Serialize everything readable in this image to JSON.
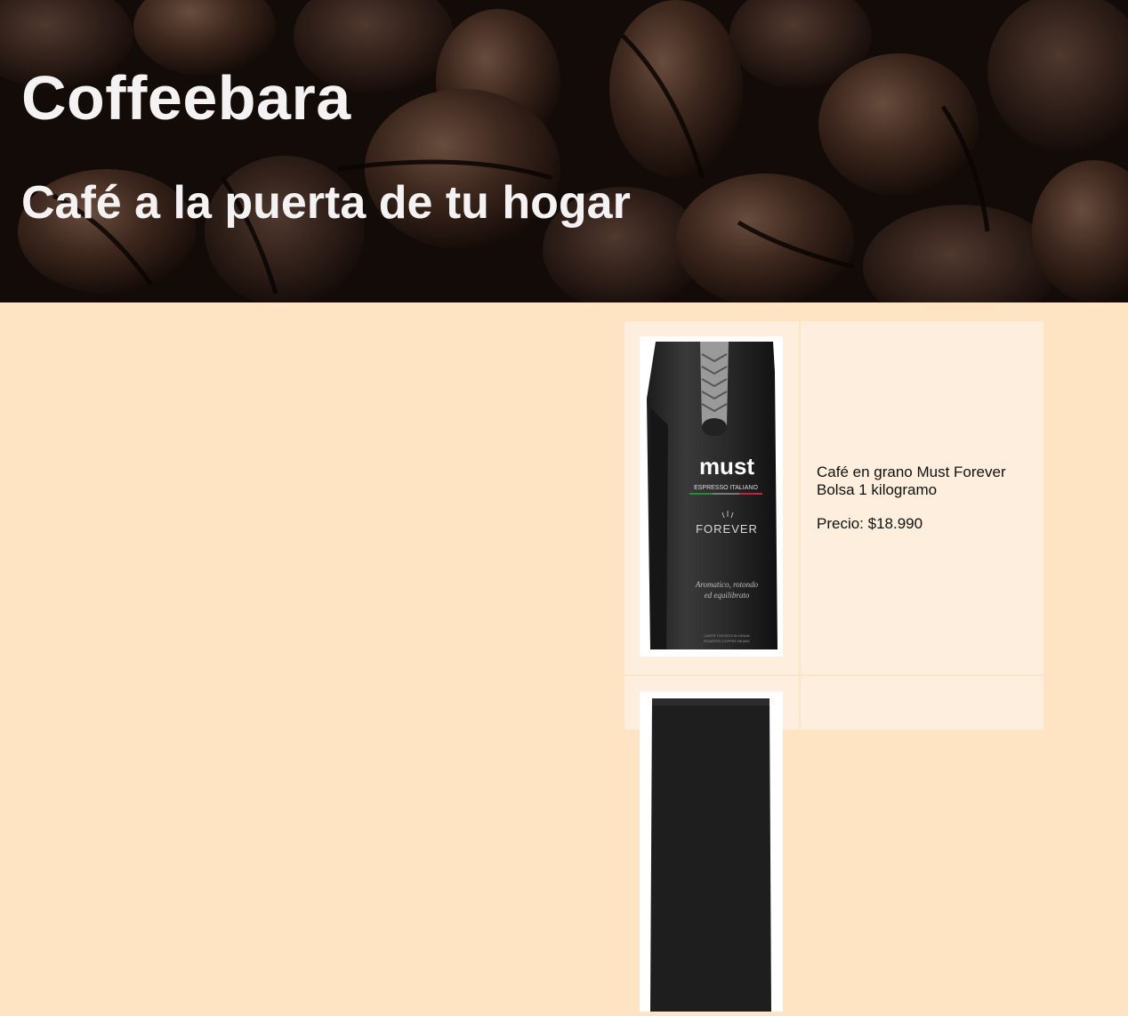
{
  "header": {
    "title": "Coffeebara",
    "subtitle": "Café a la puerta de tu hogar"
  },
  "products": [
    {
      "name": "Café en grano Must Forever Bolsa 1 kilogramo",
      "price": "Precio: $18.990",
      "image": {
        "brand": "must",
        "line": "ESPRESSO ITALIANO",
        "variant": "FOREVER",
        "tagline1": "Aromatico, rotondo",
        "tagline2": "ed equilibrato",
        "footer1": "CAFFÈ TOSTATO IN GRANI",
        "footer2": "ROASTED COFFEE BEANS"
      }
    },
    {
      "name": "",
      "price": ""
    }
  ],
  "colors": {
    "page_background": "#ffe4c4",
    "card_background": "#fdeedd",
    "hero_text": "#f4f2f2"
  }
}
